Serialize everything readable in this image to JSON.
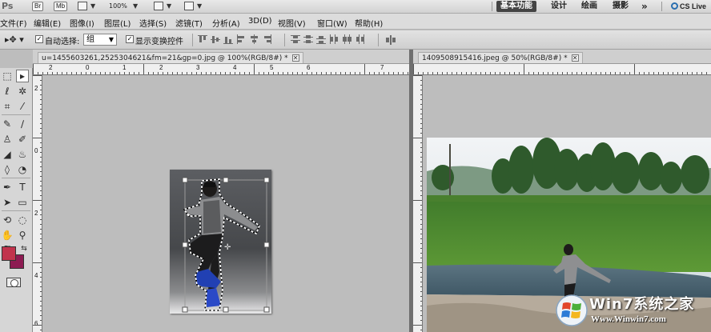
{
  "appbar": {
    "logo": "Ps",
    "bridge_label": "Br",
    "minibridge_label": "Mb",
    "zoom": "100%",
    "workspaces": [
      "基本功能",
      "设计",
      "绘画",
      "摄影"
    ],
    "more": "»",
    "cs_live": "CS Live"
  },
  "menu": [
    "文件(F)",
    "编辑(E)",
    "图像(I)",
    "图层(L)",
    "选择(S)",
    "滤镜(T)",
    "分析(A)",
    "3D(D)",
    "视图(V)",
    "窗口(W)",
    "帮助(H)"
  ],
  "options": {
    "tool_icon": "move-tool-icon",
    "auto_select_label": "自动选择:",
    "auto_select_checked": true,
    "auto_select_value": "组",
    "show_transform_label": "显示变换控件",
    "show_transform_checked": true
  },
  "doc_left": {
    "title": "u=1455603261,2525304621&fm=21&gp=0.jpg @ 100%(RGB/8#) *",
    "close": "✕",
    "ruler_h": [
      "2",
      "0",
      "1",
      "2",
      "3",
      "4",
      "5",
      "6",
      "7"
    ],
    "ruler_v": [
      "2",
      "0",
      "2",
      "4",
      "6"
    ]
  },
  "doc_right": {
    "title": "1409508915416.jpeg @ 50%(RGB/8#) *",
    "close": "✕"
  },
  "colors": {
    "foreground": "#c1334c",
    "background": "#8d1b52"
  },
  "watermark": {
    "line1": "Win7系统之家",
    "line2": "Www.Winwin7.com"
  }
}
